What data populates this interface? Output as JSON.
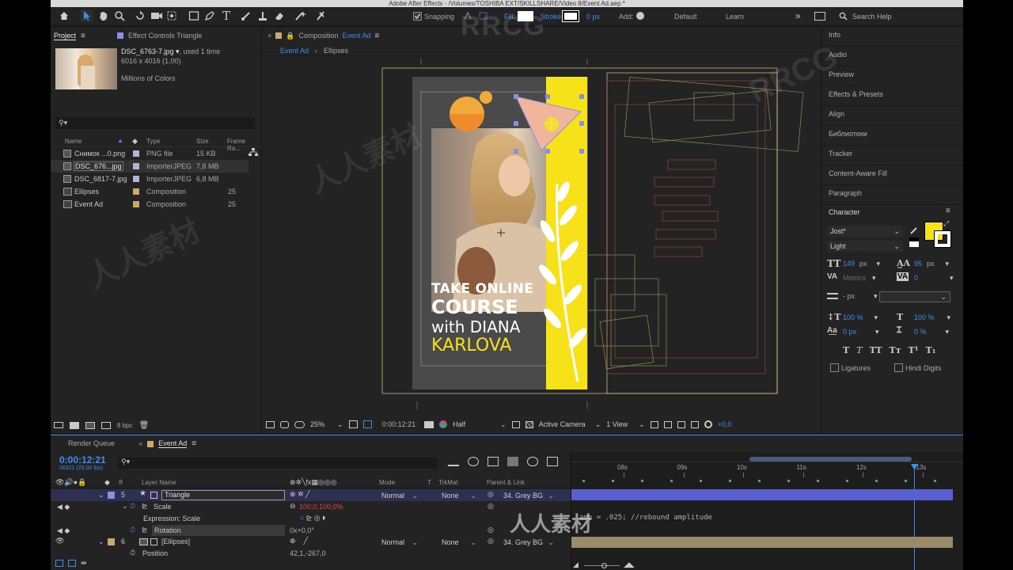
{
  "window_title": "Adobe After Effects - /Volumes/TOSHIBA EXT/SKILLSHARE/Video 8/Event Ad.aep *",
  "toolbar": {
    "snapping": "Snapping",
    "fill": "Fill:",
    "stroke": "Stroke:",
    "stroke_px": "0 px",
    "add": "Add:",
    "workspace_default": "Default",
    "workspace_learn": "Learn",
    "search_help": "Search Help"
  },
  "project": {
    "tab": "Project",
    "effect_controls_tab": "Effect Controls Triangle",
    "preview_name": "DSC_6763-7.jpg ▾",
    "preview_used": ", used 1 time",
    "preview_dims": "6016 x 4016 (1,00)",
    "preview_colors": "Millions of Colors",
    "search_placeholder": "",
    "columns": [
      "Name",
      "Type",
      "Size",
      "Frame Ra..."
    ],
    "items": [
      {
        "name": "Снимок ...0.png",
        "type": "PNG file",
        "size": "15 KB",
        "fps": "",
        "color": "#b6b0d6",
        "icon": "png-file-icon"
      },
      {
        "name": "DSC_676...jpg",
        "type": "ImporterJPEG",
        "size": "7,8 MB",
        "fps": "",
        "color": "#b6b0d6",
        "icon": "jpg-file-icon"
      },
      {
        "name": "DSC_6817-7.jpg",
        "type": "ImporterJPEG",
        "size": "6,8 MB",
        "fps": "",
        "color": "#b6b0d6",
        "icon": "jpg-file-icon"
      },
      {
        "name": "Ellipses",
        "type": "Composition",
        "size": "",
        "fps": "25",
        "color": "#c8a96e",
        "icon": "composition-icon"
      },
      {
        "name": "Event Ad",
        "type": "Composition",
        "size": "",
        "fps": "25",
        "color": "#c8a96e",
        "icon": "composition-icon"
      }
    ],
    "bpc": "8 bpc"
  },
  "composition": {
    "tab_prefix": "Composition",
    "tab_name": "Event Ad",
    "breadcrumb_current": "Event Ad",
    "breadcrumb_child": "Ellipses",
    "zoom": "25%",
    "timecode": "0:00:12:21",
    "resolution": "Half",
    "camera": "Active Camera",
    "views": "1 View",
    "exposure": "+0,0",
    "poster_lines": [
      "TAKE ONLINE",
      "COURSE",
      "with DIANA",
      "KARLOVA"
    ]
  },
  "right_panels": [
    "Info",
    "Audio",
    "Preview",
    "Effects & Presets",
    "Align",
    "Библиотеки",
    "Tracker",
    "Content-Aware Fill",
    "Paragraph"
  ],
  "character": {
    "title": "Character",
    "font": "Jost*",
    "style": "Light",
    "size": "149",
    "size_unit": "px",
    "leading": "95",
    "leading_unit": "px",
    "kerning": "Metrics",
    "tracking": "0",
    "stroke_width": "- px",
    "v_scale": "100 %",
    "h_scale": "100 %",
    "baseline": "0 px",
    "tsume": "0 %",
    "ligatures": "Ligatures",
    "hindi_digits": "Hindi Digits",
    "fill_color": "#f7e21a"
  },
  "timeline": {
    "render_queue_tab": "Render Queue",
    "comp_tab": "Event Ad",
    "timecode": "0:00:12:21",
    "frames": "00321 (25.00 fps)",
    "col_layer_name": "Layer Name",
    "col_mode": "Mode",
    "col_t": "T",
    "col_trkmat": "TrkMat",
    "col_parent": "Parent & Link",
    "ruler": [
      "08s",
      "09s",
      "10s",
      "11s",
      "12s",
      "13s"
    ],
    "layers": [
      {
        "num": "5",
        "name": "Triangle",
        "mode": "Normal",
        "trkmat": "None",
        "parent": "34. Grey BG",
        "color": "#8a8fe6"
      },
      {
        "num": "6",
        "name": "[Ellipses]",
        "mode": "Normal",
        "trkmat": "None",
        "parent": "34. Grey BG",
        "color": "#c8a96e"
      }
    ],
    "scale_label": "Scale",
    "scale_value": "100,0,100,0%",
    "expression_label": "Expression: Scale",
    "rotation_label": "Rotation",
    "rotation_value": "0x+0,0°",
    "position_label": "Position",
    "position_value": "42,1,-267,0",
    "expression_text": "amp = .025; //rebound amplitude"
  },
  "watermarks": [
    "RRCG",
    "人人素材",
    "RRCG",
    "人人素材",
    "人人素材"
  ]
}
